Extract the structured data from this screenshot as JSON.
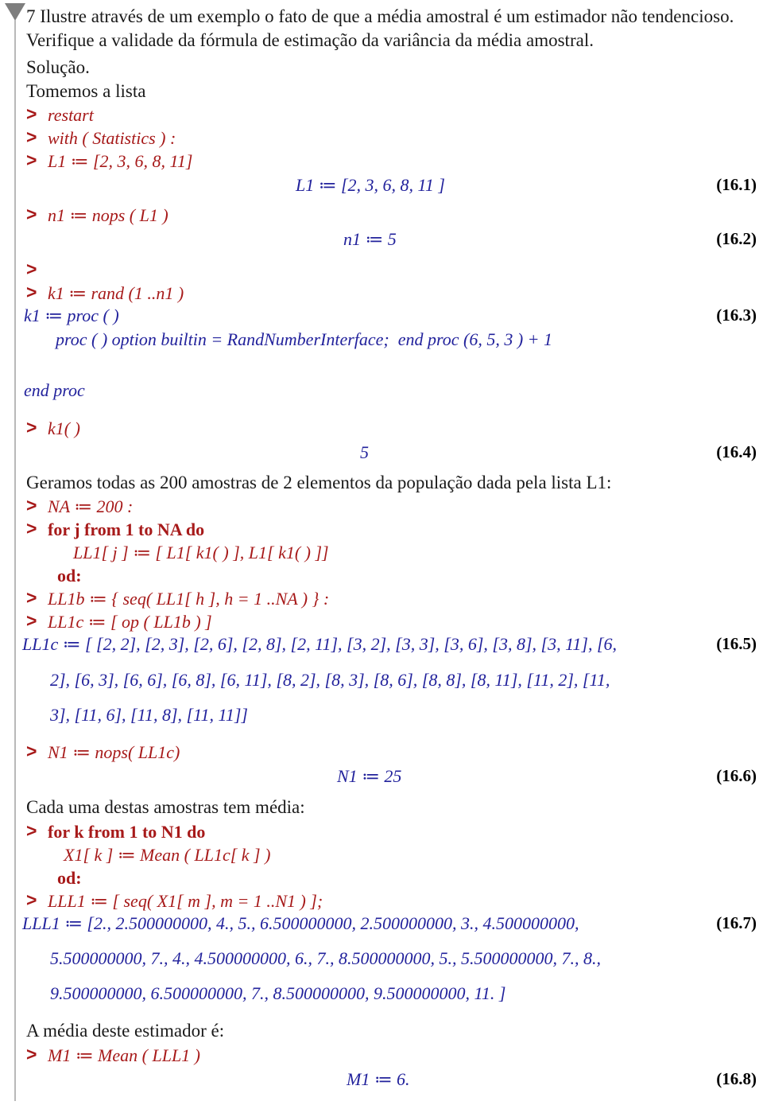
{
  "document": {
    "type": "maple-worksheet",
    "colors": {
      "input": "#a71a1a",
      "output": "#22229c",
      "prose": "#1a1a1a",
      "label": "#000000",
      "marker": "#7e7e7e",
      "marker_line": "#b9b9b9"
    },
    "group_marker_icon": "triangle-down-icon"
  },
  "prose": {
    "exercise_line1": "7 Ilustre através de um exemplo o fato de que a média amostral é um estimador não tendencioso.",
    "exercise_line2": "Verifique a validade da fórmula de estimação da variância da média amostral.",
    "solution": "Solução.",
    "take_list": "Tomemos a lista",
    "generate_samples": "Geramos todas as 200 amostras  de 2 elementos da população dada pela lista L1:",
    "each_sample_mean": "Cada uma destas amostras tem média:",
    "estimator_mean": "A média deste estimador é:"
  },
  "prompt_symbol": ">",
  "inputs": {
    "restart": "restart",
    "with_statistics": "with ( Statistics ) :",
    "L1_assign": "L1 ≔ [2, 3, 6, 8, 11]",
    "n1_assign": "n1 ≔ nops ( L1 )",
    "empty": "",
    "k1_assign": "k1 ≔ rand (1 ..n1 )",
    "k1_call": "k1( )",
    "NA_assign": "NA ≔ 200 :",
    "for_j_head": "for j from 1 to NA do",
    "for_j_body": "LL1[ j ] ≔ [ L1[ k1( ) ], L1[ k1( ) ]]",
    "for_j_end": "od:",
    "LL1b_assign": "LL1b ≔ { seq( LL1[ h ], h = 1 ..NA ) } :",
    "LL1c_assign": "LL1c ≔ [ op ( LL1b ) ]",
    "N1_assign": "N1 ≔ nops( LL1c)",
    "for_k_head": "for k from 1 to N1 do",
    "for_k_body": "X1[ k ] ≔ Mean ( LL1c[ k ] )",
    "for_k_end": "od:",
    "LLL1_assign": "LLL1 ≔ [ seq( X1[ m ], m = 1 ..N1 ) ];",
    "M1_assign": "M1 ≔ Mean ( LLL1 )"
  },
  "outputs": {
    "o_16_1": "L1 ≔ [2, 3, 6, 8, 11 ]",
    "o_16_2": "n1 ≔ 5",
    "o_16_3_line1": "k1 ≔ proc ( )",
    "o_16_3_line2": "proc ( ) option builtin = RandNumberInterface;  end proc (6, 5, 3 ) + 1",
    "o_16_3_line3": "end proc",
    "o_16_4": "5",
    "o_16_5_line1": "LL1c ≔ [ [2, 2], [2, 3], [2, 6], [2, 8], [2, 11], [3, 2], [3, 3], [3, 6], [3, 8], [3, 11], [6,",
    "o_16_5_line2": "2], [6, 3], [6, 6], [6, 8], [6, 11], [8, 2], [8, 3], [8, 6], [8, 8], [8, 11], [11, 2], [11,",
    "o_16_5_line3": "3], [11, 6], [11, 8], [11, 11]]",
    "o_16_6": "N1 ≔ 25",
    "o_16_7_line1": "LLL1 ≔ [2., 2.500000000, 4., 5., 6.500000000, 2.500000000, 3., 4.500000000,",
    "o_16_7_line2": "5.500000000, 7., 4., 4.500000000, 6., 7., 8.500000000, 5., 5.500000000, 7., 8.,",
    "o_16_7_line3": "9.500000000, 6.500000000, 7., 8.500000000, 9.500000000, 11. ]",
    "o_16_8": "M1 ≔ 6."
  },
  "labels": {
    "l1": "(16.1)",
    "l2": "(16.2)",
    "l3": "(16.3)",
    "l4": "(16.4)",
    "l5": "(16.5)",
    "l6": "(16.6)",
    "l7": "(16.7)",
    "l8": "(16.8)"
  }
}
